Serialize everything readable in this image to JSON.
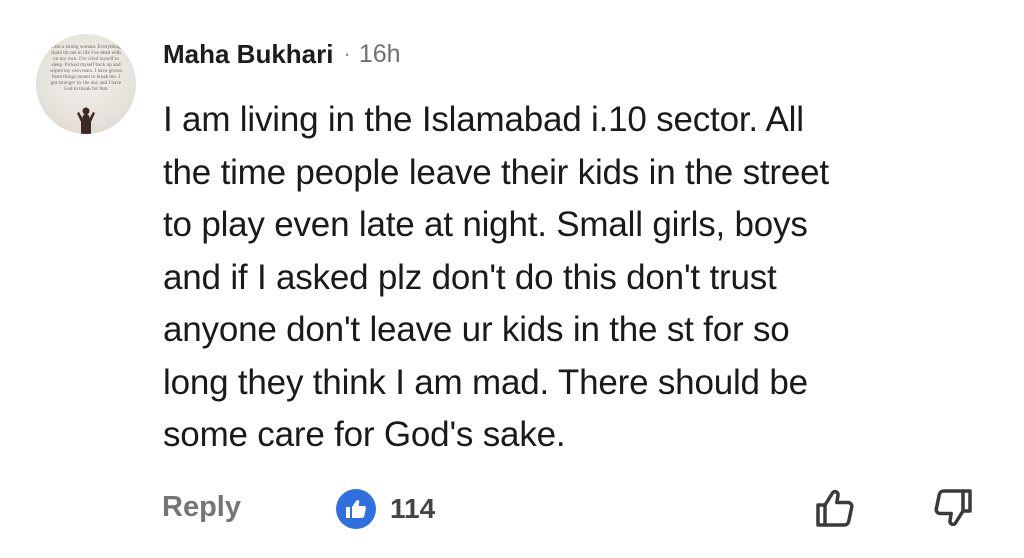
{
  "comment": {
    "author": "Maha Bukhari",
    "separator": "·",
    "timestamp": "16h",
    "lines": [
      "I am living in the Islamabad i.10 sector. All",
      "the time people leave their kids in the street",
      "to play even late at night. Small girls, boys",
      "and if I asked plz don't do this don't trust",
      "anyone don't leave ur kids in the st for so",
      "long they think I am mad. There should be",
      "some care for God's sake."
    ]
  },
  "avatar": {
    "text": "I am a strong woman. Everything that's hit me in life I've dealt with on my own. I've cried myself to sleep. Picked myself back up and wiped my own tears. I have grown from things meant to break me. I get stronger by the day and I have God to thank for that."
  },
  "actions": {
    "reply_label": "Reply",
    "like_count": "114",
    "like_badge_color": "#2f6fdf"
  },
  "icons": {
    "like_badge": "thumbs-up-icon",
    "upvote": "thumbs-up-outline-icon",
    "downvote": "thumbs-down-outline-icon"
  }
}
